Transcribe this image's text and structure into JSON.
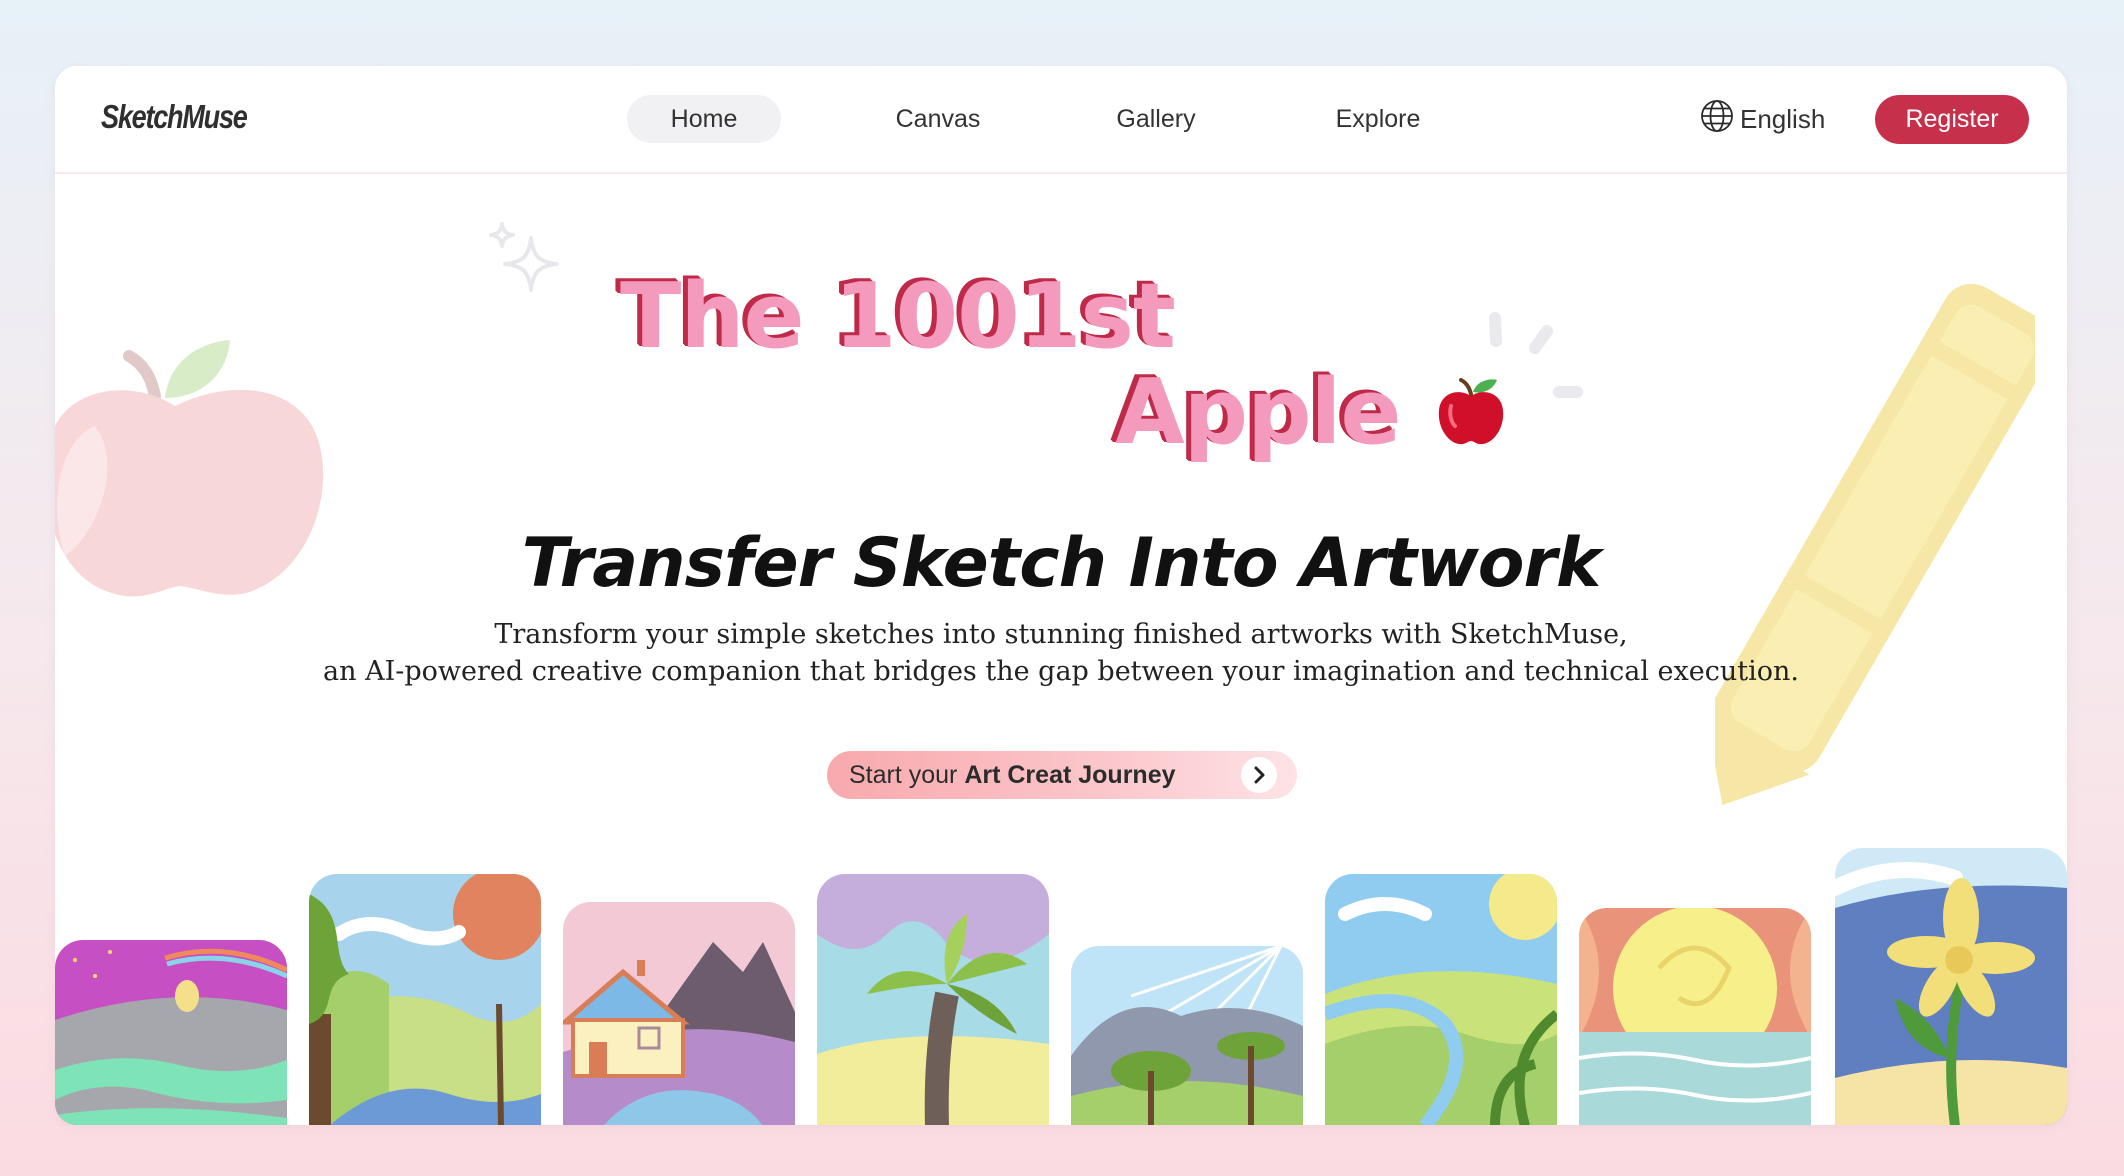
{
  "header": {
    "logo": "SketchMuse",
    "nav": [
      {
        "label": "Home",
        "active": true
      },
      {
        "label": "Canvas",
        "active": false
      },
      {
        "label": "Gallery",
        "active": false
      },
      {
        "label": "Explore",
        "active": false
      }
    ],
    "language": "English",
    "register_label": "Register"
  },
  "hero": {
    "title_line1": "The 1001st",
    "title_line2": "Apple",
    "title_emoji": "🍎",
    "subtitle": "Transfer Sketch Into Artwork",
    "description_line1": "Transform your simple sketches into stunning finished artworks with SketchMuse,",
    "description_line2": "an AI-powered creative companion that bridges the gap between your imagination and technical execution.",
    "cta_prefix": "Start your ",
    "cta_strong": "Art Creat Journey"
  },
  "colors": {
    "accent": "#c7304a",
    "title_fill": "#f49bbd",
    "title_shadow": "#c02a49",
    "cta_gradient_start": "#f8a9ac"
  },
  "icons": {
    "language": "globe-icon",
    "cta": "chevron-right-icon",
    "decor": [
      "sparkle-icon",
      "apple-icon",
      "pencil-icon",
      "burst-lines-icon"
    ]
  }
}
